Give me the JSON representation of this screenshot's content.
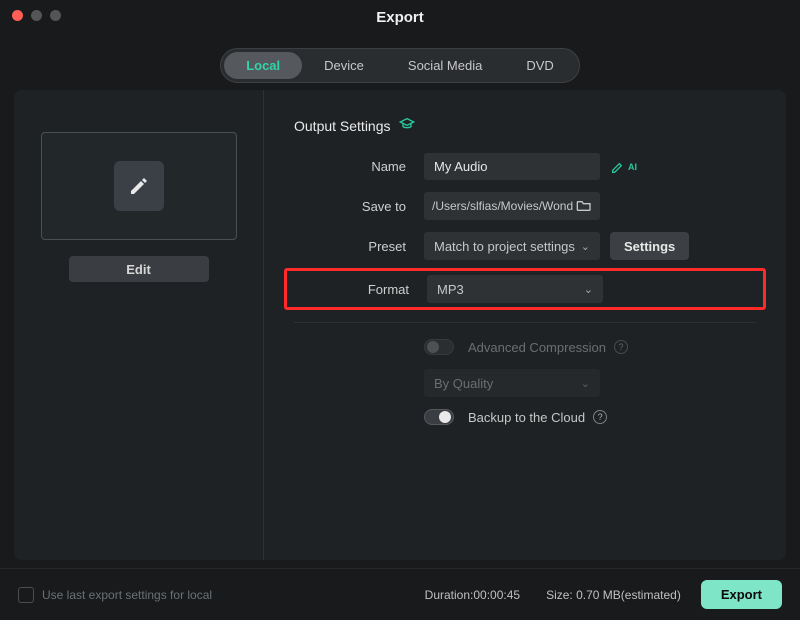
{
  "window": {
    "title": "Export"
  },
  "tabs": {
    "local": "Local",
    "device": "Device",
    "social": "Social Media",
    "dvd": "DVD"
  },
  "left": {
    "edit": "Edit"
  },
  "settings": {
    "heading": "Output Settings",
    "name_label": "Name",
    "name_value": "My Audio",
    "ai_suffix": "AI",
    "saveto_label": "Save to",
    "saveto_value": "/Users/slfias/Movies/Wond",
    "preset_label": "Preset",
    "preset_value": "Match to project settings",
    "settings_btn": "Settings",
    "format_label": "Format",
    "format_value": "MP3",
    "adv_label": "Advanced Compression",
    "quality_value": "By Quality",
    "backup_label": "Backup to the Cloud"
  },
  "footer": {
    "uselast": "Use last export settings for local",
    "duration_label": "Duration:",
    "duration_value": "00:00:45",
    "size_label": "Size:",
    "size_value": "0.70 MB(estimated)",
    "export_btn": "Export"
  }
}
